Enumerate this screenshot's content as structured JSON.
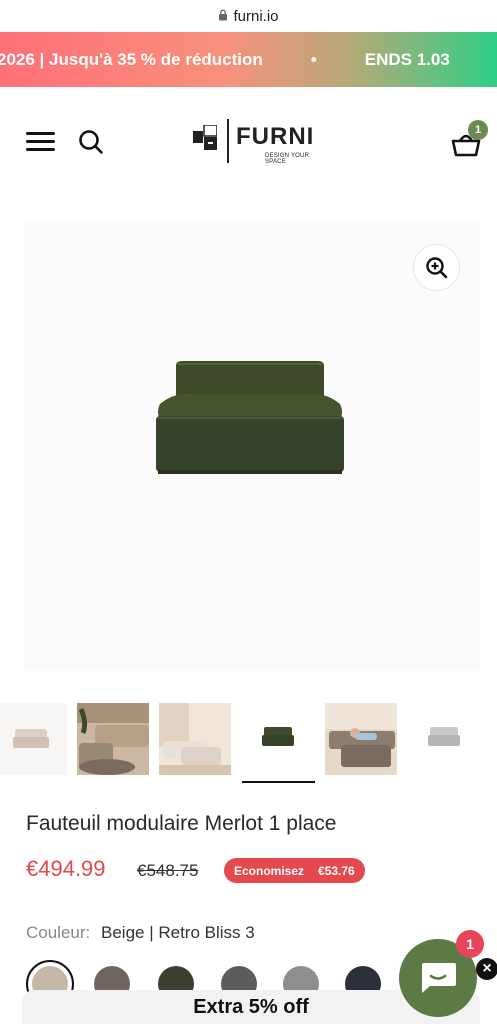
{
  "browser": {
    "url": "furni.io",
    "lock_icon": "lock-icon"
  },
  "promo": {
    "text_left": "2026 | Jusqu'à 35 % de réduction",
    "separator": "•",
    "text_right": "ENDS 1.03"
  },
  "header": {
    "logo_word": "FURNI",
    "logo_tagline": "DESIGN YOUR SPACE",
    "cart_count": "1",
    "icons": {
      "menu": "hamburger-menu-icon",
      "search": "search-icon",
      "cart": "basket-icon"
    }
  },
  "gallery": {
    "zoom_icon": "zoom-in-icon",
    "thumbnails": [
      {
        "alt": "beige sofa module"
      },
      {
        "alt": "brown sofa with ottoman in room"
      },
      {
        "alt": "cream sofa in living room"
      },
      {
        "alt": "green sofa module",
        "active": true
      },
      {
        "alt": "taupe modular sofa with people"
      },
      {
        "alt": "grey sofa module"
      }
    ]
  },
  "product": {
    "title": "Fauteuil modulaire Merlot 1 place",
    "price": "€494.99",
    "old_price": "€548.75",
    "save_label": "Economisez",
    "save_amount": "€53.76",
    "color_label": "Couleur:",
    "color_value": "Beige | Retro Bliss 3"
  },
  "swatch_colors": [
    "#c6b8a9",
    "#6e6560",
    "#3b4030",
    "#5c5c5c",
    "#8e8e8e",
    "#2c3038"
  ],
  "extra_banner": {
    "text": "Extra 5% off"
  },
  "chat": {
    "badge": "1",
    "icon": "chat-bubble-icon",
    "close": "×"
  },
  "colors": {
    "accent_red": "#e5484d",
    "brand_green": "#5c7a43",
    "badge_green": "#6c8b52"
  }
}
